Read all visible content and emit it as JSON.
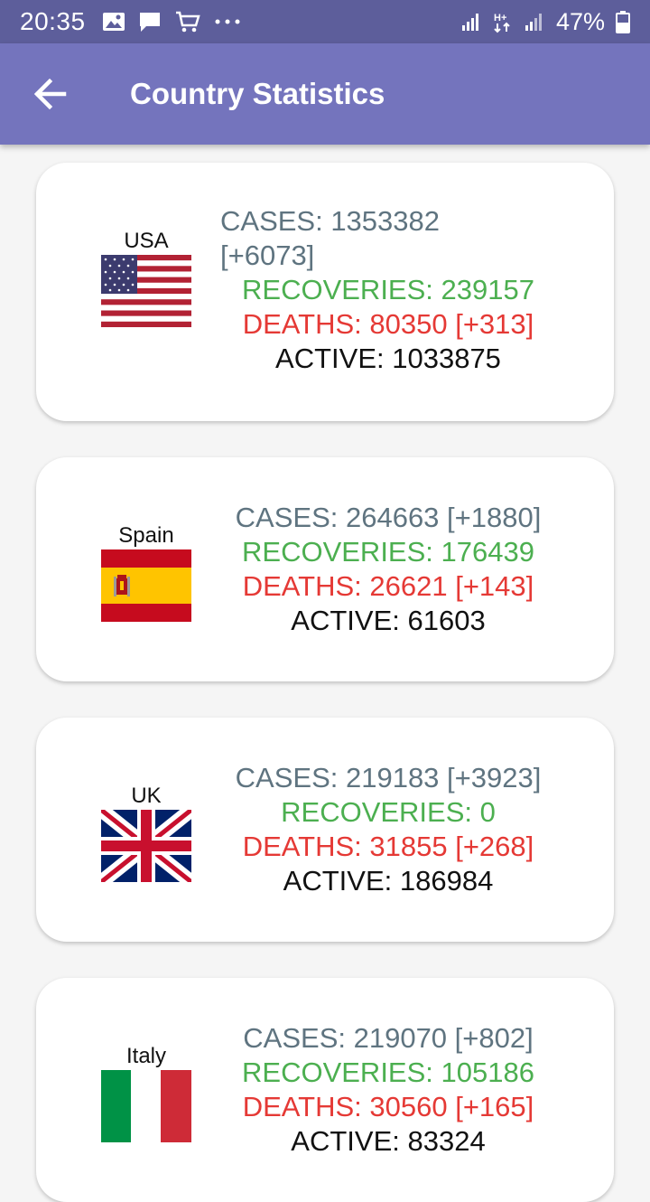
{
  "status_bar": {
    "time": "20:35",
    "battery": "47%"
  },
  "app_bar": {
    "title": "Country Statistics"
  },
  "countries": [
    {
      "name": "USA",
      "cases_line1": "CASES: 1353382",
      "cases_line2": "[+6073]",
      "recoveries": "RECOVERIES: 239157",
      "deaths": "DEATHS: 80350  [+313]",
      "active": "ACTIVE: 1033875"
    },
    {
      "name": "Spain",
      "cases": "CASES: 264663  [+1880]",
      "recoveries": "RECOVERIES: 176439",
      "deaths": "DEATHS: 26621  [+143]",
      "active": "ACTIVE: 61603"
    },
    {
      "name": "UK",
      "cases": "CASES: 219183  [+3923]",
      "recoveries": "RECOVERIES: 0",
      "deaths": "DEATHS: 31855  [+268]",
      "active": "ACTIVE: 186984"
    },
    {
      "name": "Italy",
      "cases": "CASES: 219070  [+802]",
      "recoveries": "RECOVERIES: 105186",
      "deaths": "DEATHS: 30560  [+165]",
      "active": "ACTIVE: 83324"
    }
  ],
  "colors": {
    "status_bar": "#5d5e9b",
    "app_bar": "#7474bd",
    "cases": "#5f7480",
    "recoveries": "#4caf50",
    "deaths": "#e53935",
    "active": "#111111"
  }
}
